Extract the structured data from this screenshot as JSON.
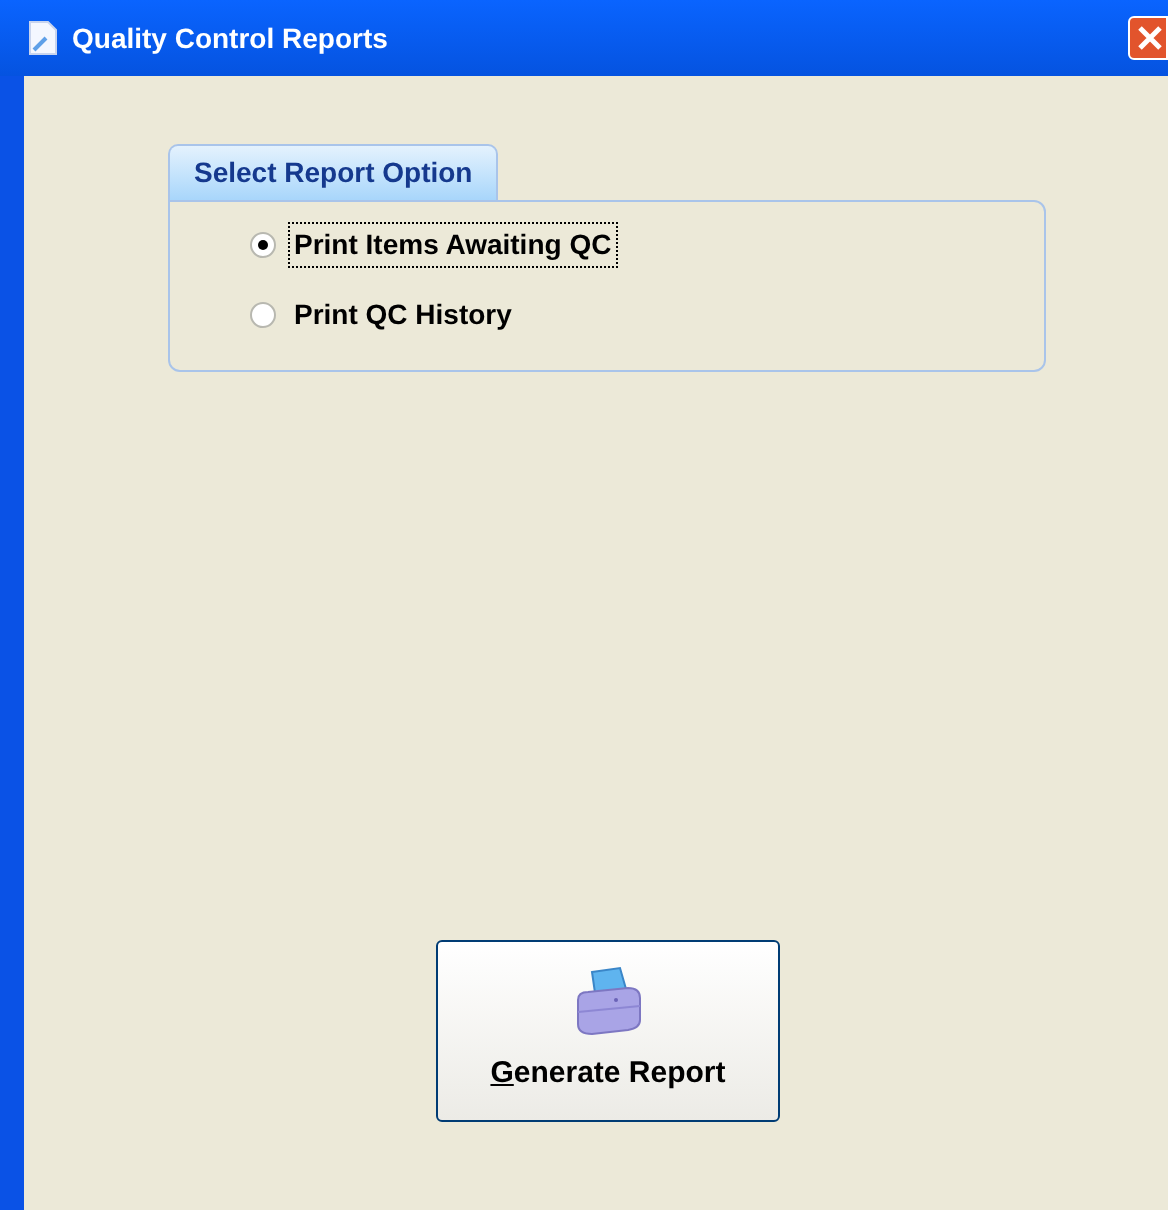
{
  "window": {
    "title": "Quality Control Reports"
  },
  "group": {
    "title": "Select Report Option",
    "options": [
      {
        "label": "Print Items Awaiting QC",
        "selected": true
      },
      {
        "label": "Print QC History",
        "selected": false
      }
    ]
  },
  "button": {
    "label": "Generate Report",
    "underline_first": true
  }
}
